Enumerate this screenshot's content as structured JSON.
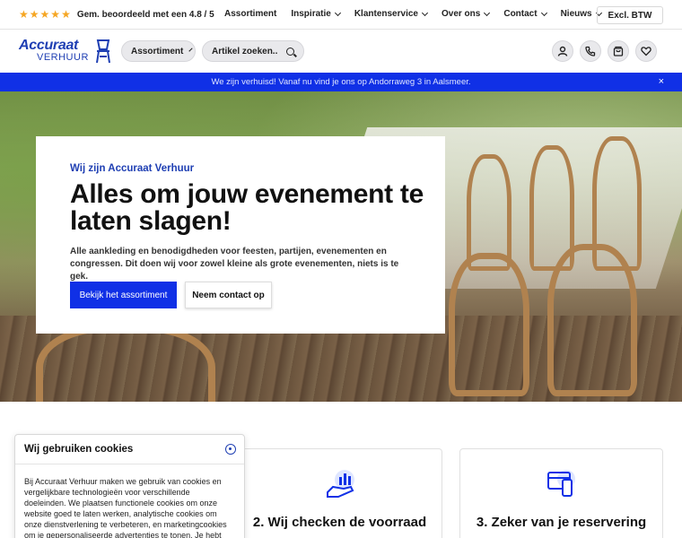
{
  "topbar": {
    "stars": [
      "★",
      "★",
      "★",
      "★",
      "★"
    ],
    "rating_text": "Gem. beoordeeld met een 4.8 / 5",
    "nav": [
      {
        "label": "Assortiment",
        "dropdown": false
      },
      {
        "label": "Inspiratie",
        "dropdown": true
      },
      {
        "label": "Klantenservice",
        "dropdown": true
      },
      {
        "label": "Over ons",
        "dropdown": true
      },
      {
        "label": "Contact",
        "dropdown": true
      },
      {
        "label": "Nieuws",
        "dropdown": true
      }
    ],
    "btw_label": "Excl. BTW"
  },
  "header": {
    "logo_top": "Accuraat",
    "logo_bottom": "VERHUUR",
    "assortiment_label": "Assortiment",
    "search_placeholder": "Artikel zoeken.."
  },
  "banner": {
    "text": "We zijn verhuisd! Vanaf nu vind je ons op Andorraweg 3 in Aalsmeer.",
    "close": "×"
  },
  "hero": {
    "eyebrow": "Wij zijn Accuraat Verhuur",
    "title": "Alles om jouw evenement te laten slagen!",
    "subtitle": "Alle aankleding en benodigdheden voor feesten, partijen, evenementen en congressen. Dit doen wij voor zowel kleine als grote evenementen, niets is te gek.",
    "primary_button": "Bekijk het assortiment",
    "secondary_button": "Neem contact op"
  },
  "features": [
    {
      "title": "2. Wij checken de voorraad"
    },
    {
      "title": "3. Zeker van je reservering"
    }
  ],
  "cookie": {
    "title": "Wij gebruiken cookies",
    "body": "Bij Accuraat Verhuur maken we gebruik van cookies en vergelijkbare technologieën voor verschillende doeleinden. We plaatsen functionele cookies om onze website goed te laten werken, analytische cookies om onze dienstverlening te verbeteren, en marketingcookies om je gepersonaliseerde advertenties te tonen. Je hebt"
  },
  "colors": {
    "brand_blue": "#1030e6",
    "logo_blue": "#1f3fb3",
    "star": "#f5a623"
  }
}
